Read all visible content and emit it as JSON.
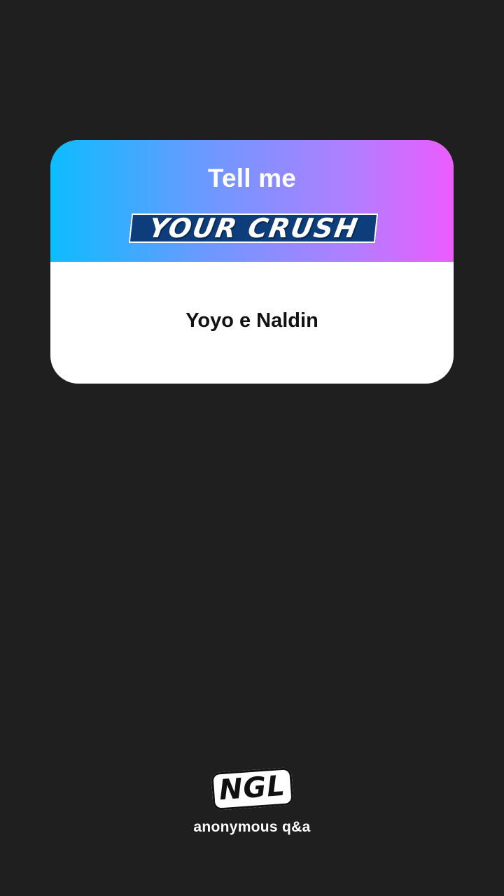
{
  "card": {
    "title": "Tell me",
    "badge": "YOUR CRUSH",
    "answer": "Yoyo e Naldin"
  },
  "brand": {
    "logo": "NGL",
    "tagline": "anonymous q&a"
  },
  "colors": {
    "background": "#1f1f1f",
    "gradient_start": "#0dbcff",
    "gradient_end": "#ec5cff",
    "badge_fill": "#0d3d7a"
  }
}
